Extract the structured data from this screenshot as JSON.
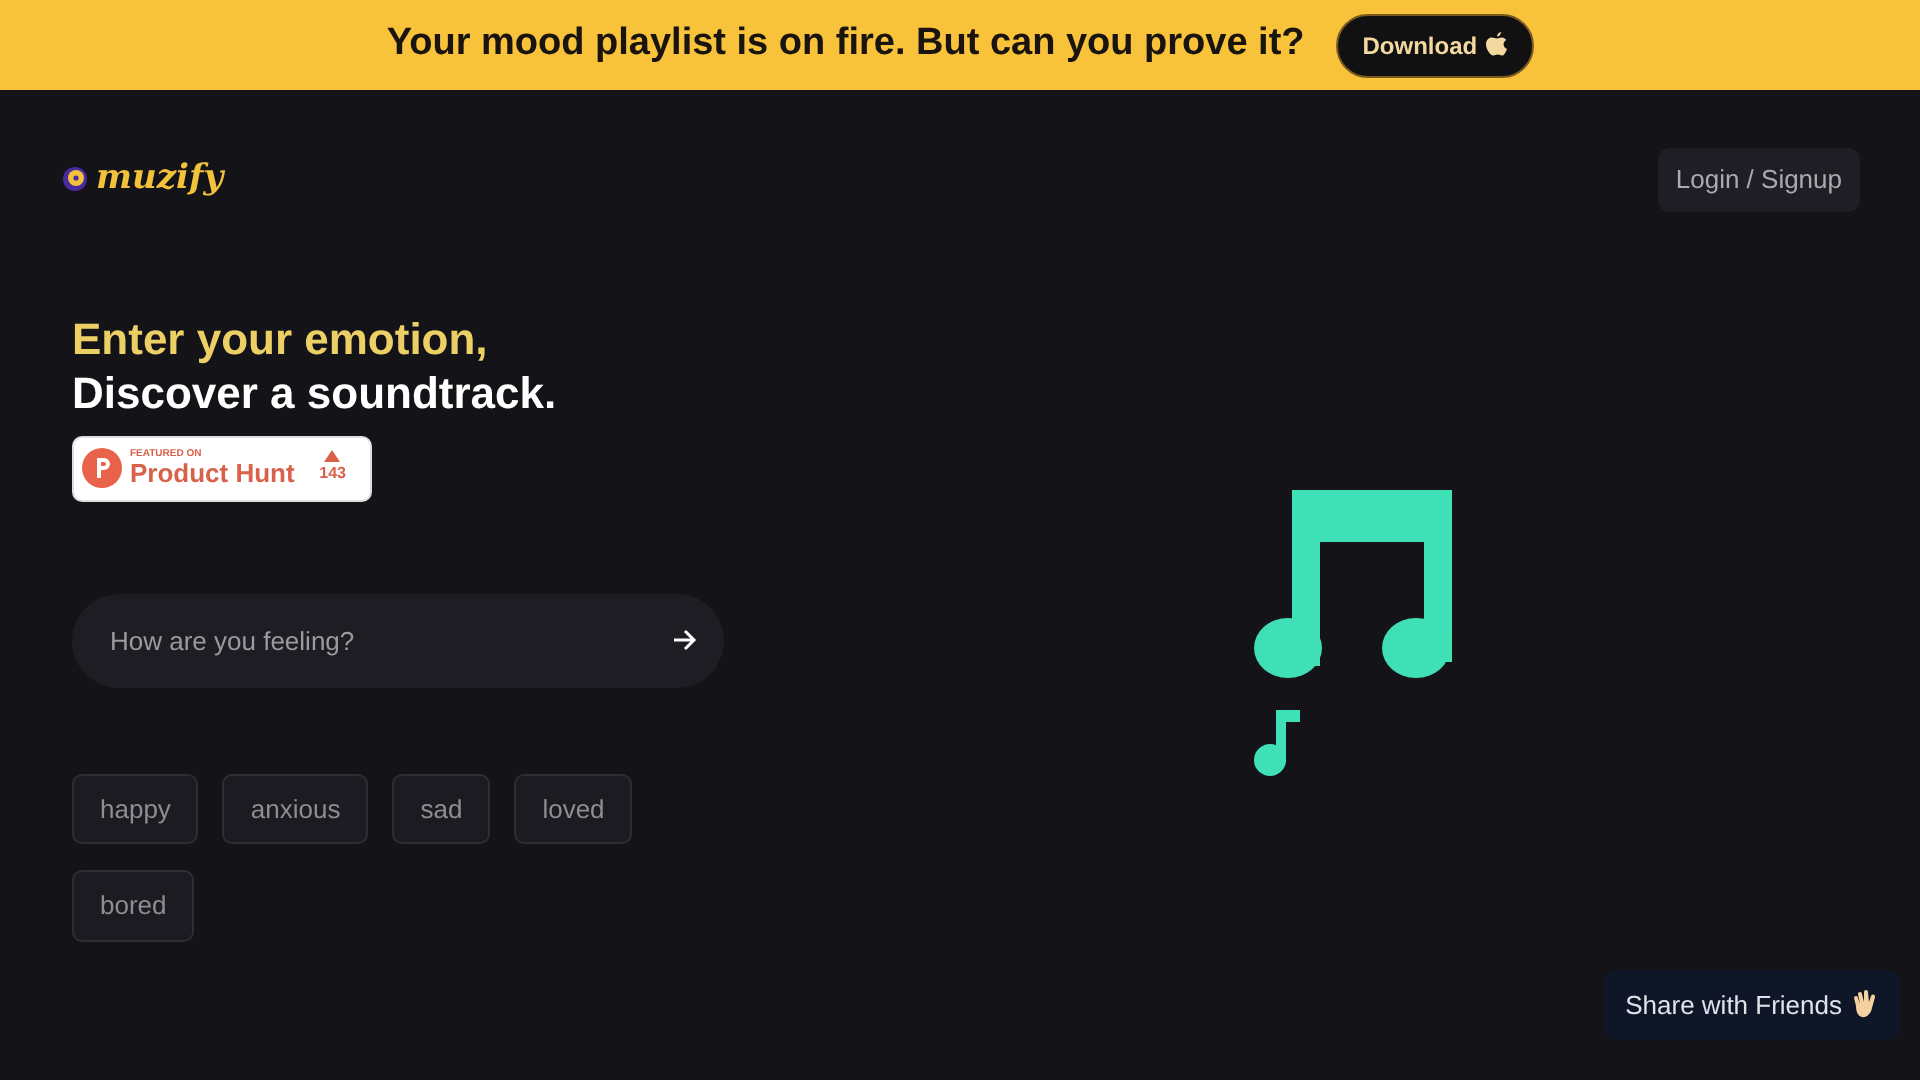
{
  "banner": {
    "text": "Your mood playlist is on fire. But can you prove it?",
    "button": "Download"
  },
  "header": {
    "logo": "muzify",
    "login": "Login / Signup"
  },
  "hero": {
    "line_1": "Enter your emotion,",
    "line_2": "Discover a soundtrack."
  },
  "product_hunt": {
    "caption": "FEATURED ON",
    "name": "Product Hunt",
    "votes": "143"
  },
  "search": {
    "placeholder": "How are you feeling?"
  },
  "moods": [
    "happy",
    "anxious",
    "sad",
    "loved",
    "bored"
  ],
  "share": {
    "label": "Share with Friends"
  }
}
